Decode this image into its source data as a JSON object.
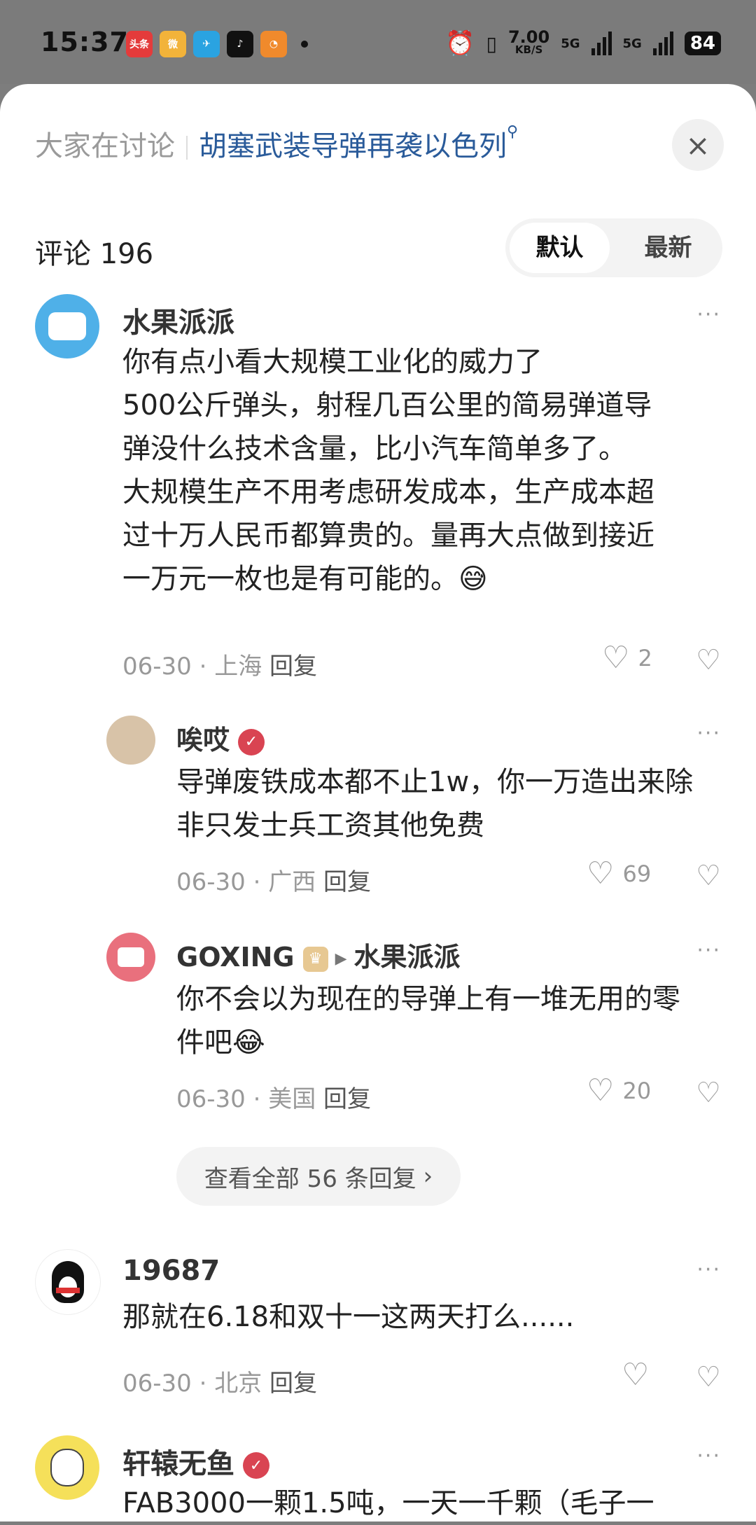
{
  "status": {
    "time": "15:37",
    "apps": [
      {
        "name": "toutiao-icon",
        "label": "头条",
        "color": "#e43b3b"
      },
      {
        "name": "weibo-icon",
        "label": "微",
        "color": "#f2b33a"
      },
      {
        "name": "telegram-icon",
        "label": "✈",
        "color": "#2aa3e1"
      },
      {
        "name": "tiktok-icon",
        "label": "♪",
        "color": "#111111"
      },
      {
        "name": "orange-app-icon",
        "label": "◔",
        "color": "#f08a2c"
      }
    ],
    "speed_value": "7.00",
    "speed_unit": "KB/S",
    "net1": "5G",
    "net2": "5G",
    "battery": "84"
  },
  "header": {
    "label": "大家在讨论",
    "topic": "胡塞武装导弹再袭以色列"
  },
  "comments_header": {
    "count": "评论 196",
    "sort_default": "默认",
    "sort_latest": "最新"
  },
  "comments": [
    {
      "user": "水果派派",
      "text": [
        "你有点小看大规模工业化的威力了",
        "500公斤弹头，射程几百公里的简易弹道导",
        "弹没什么技术含量，比小汽车简单多了。",
        "大规模生产不用考虑研发成本，生产成本超",
        "过十万人民币都算贵的。量再大点做到接近",
        "一万元一枚也是有可能的。😅"
      ],
      "date": "06-30",
      "location": "上海",
      "reply": "回复",
      "likes": "2"
    },
    {
      "user": "19687",
      "text": [
        "那就在6.18和双十一这两天打么......"
      ],
      "date": "06-30",
      "location": "北京",
      "reply": "回复",
      "likes": ""
    },
    {
      "user": "轩辕无鱼",
      "text": [
        "FAB3000一颗1.5吨，一天一千颗（毛子一"
      ],
      "date": "",
      "location": "",
      "reply": "",
      "likes": ""
    }
  ],
  "replies": [
    {
      "user": "唉哎",
      "text": [
        "导弹废铁成本都不止1w，你一万造出来除",
        "非只发士兵工资其他免费"
      ],
      "date": "06-30",
      "location": "广西",
      "reply": "回复",
      "likes": "69"
    },
    {
      "user": "GOXING",
      "reply_to": "水果派派",
      "text": [
        "你不会以为现在的导弹上有一堆无用的零",
        "件吧😂"
      ],
      "date": "06-30",
      "location": "美国",
      "reply": "回复",
      "likes": "20"
    }
  ],
  "view_all": "查看全部 56 条回复",
  "icons": {
    "close": "×",
    "more": "···",
    "heart": "♡",
    "dislike": "♡",
    "chevron": "›"
  }
}
